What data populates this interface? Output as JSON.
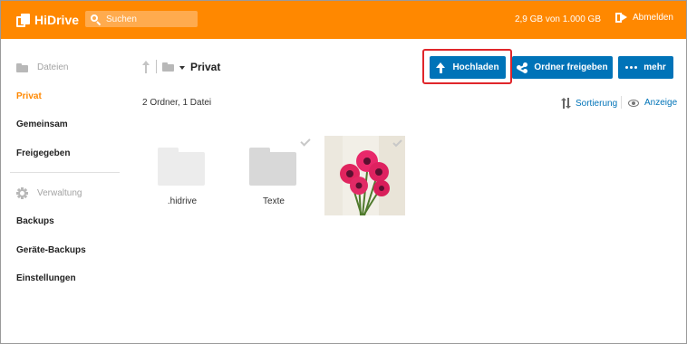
{
  "header": {
    "logo_text": "HiDrive",
    "search_placeholder": "Suchen",
    "storage_text": "2,9 GB von 1.000 GB",
    "logout_label": "Abmelden",
    "brand_color": "#ff8800"
  },
  "sidebar": {
    "files_section": "Dateien",
    "files_icon": "folder-icon",
    "items": [
      {
        "label": "Privat",
        "active": true
      },
      {
        "label": "Gemeinsam"
      },
      {
        "label": "Freigegeben"
      }
    ],
    "admin_section": "Verwaltung",
    "admin_icon": "gear-icon",
    "admin_items": [
      {
        "label": "Backups"
      },
      {
        "label": "Geräte-Backups"
      },
      {
        "label": "Einstellungen"
      }
    ]
  },
  "main": {
    "breadcrumb_title": "Privat",
    "item_count": "2 Ordner, 1 Datei",
    "buttons": {
      "upload": "Hochladen",
      "share_folder": "Ordner freigeben",
      "more": "mehr"
    },
    "sort_label": "Sortierung",
    "view_label": "Anzeige",
    "accent_color": "#0073b8",
    "files": [
      {
        "name": ".hidrive",
        "type": "folder",
        "hidden": true
      },
      {
        "name": "Texte",
        "type": "folder"
      },
      {
        "name": "",
        "type": "image",
        "description_icon": "flower-photo"
      }
    ]
  }
}
